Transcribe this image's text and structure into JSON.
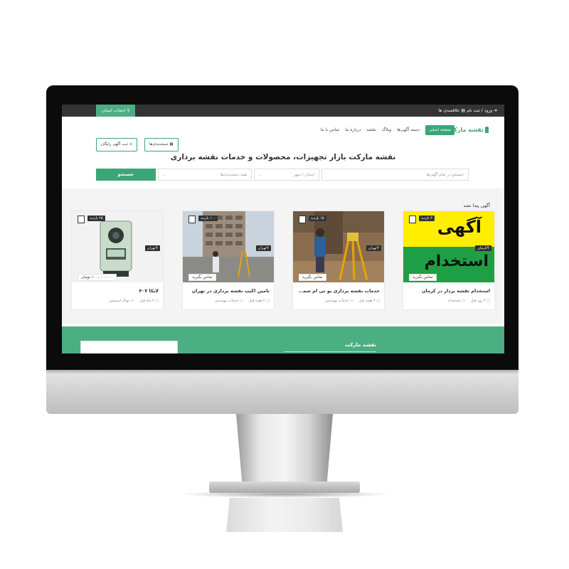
{
  "topbar": {
    "login": "ورود / ثبت نام",
    "favorites": "علاقمندی ها",
    "province_button": "انتخاب استان"
  },
  "header": {
    "logo": "نقشه مارکت",
    "menu": [
      "صفحه اصلی",
      "دسته آگهی‌ها",
      "وبلاگ",
      "نقشه",
      "درباره ما",
      "تماس با ما"
    ],
    "post_ad_button": "+ ثبت آگهی رایگان",
    "categories_button": "دسته‌بندی‌ها"
  },
  "hero": {
    "headline": "نقشه مارکت بازار تجهیزات، محصولات و خدمات نقشه برداری"
  },
  "search": {
    "placeholder": "جستجو در تمام آگهی‌ها",
    "province_placeholder": "استان / شهر",
    "category_placeholder": "همه دسته‌بندی‌ها",
    "button": "جستجو"
  },
  "notice": "آگهی پیدا نشد",
  "cards": [
    {
      "views": "۳ بازدید",
      "location": "کرمان",
      "price": "تماس بگیرید",
      "title": "استخدام نقشه بردار در کرمان",
      "time": "۴ روز قبل",
      "category": "استخدام",
      "ad_line1": "آگهی",
      "ad_line2": "استخدام"
    },
    {
      "views": "۱۵ بازدید",
      "location": "تهران",
      "price": "تماس بگیرید",
      "title": "خدمات نقشه برداری یو تی ام شمیم ...",
      "time": "۲ هفته قبل",
      "category": "خدمات مهندسی"
    },
    {
      "views": "۱۰۰ بازدید",
      "location": "تهران",
      "price": "تماس بگیرید",
      "title": "تامین اکیپ نقشه برداری در تهران",
      "time": "۲ هفته قبل",
      "category": "خدمات مهندسی"
    },
    {
      "views": "۲۵ بازدید",
      "location": "تهران",
      "price": "۱۰۰,۰۰۰,۰۰۰ تومان",
      "title": "لایکا ۴۰۷",
      "time": "۲ ماه قبل",
      "category": "توتال استیشن"
    }
  ],
  "footer": {
    "title": "نقشه مارکت"
  },
  "colors": {
    "brand_green": "#3aa676",
    "footer_green": "#4cae83",
    "topbar_dark": "#343434"
  }
}
